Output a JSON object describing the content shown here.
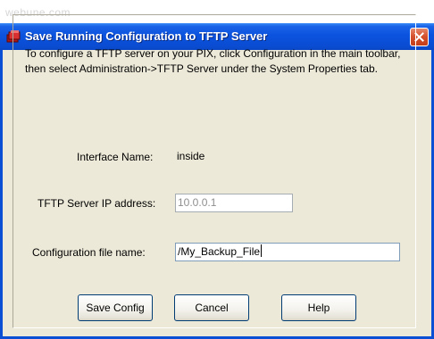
{
  "watermark": "webune.com",
  "window": {
    "title": "Save Running Configuration to TFTP Server",
    "icon": "application-icon",
    "close_icon": "close-icon"
  },
  "dialog": {
    "instructions": "To configure a TFTP server on your PIX, click Configuration in the main toolbar, then select Administration->TFTP Server under the System Properties tab.",
    "interface_label": "Interface Name:",
    "interface_value": "inside",
    "tftp_ip_label": "TFTP Server IP address:",
    "tftp_ip_value": "10.0.0.1",
    "config_file_label": "Configuration file name:",
    "config_file_value": "/My_Backup_File"
  },
  "buttons": {
    "save": "Save Config",
    "cancel": "Cancel",
    "help": "Help"
  },
  "colors": {
    "titlebar": "#0a4cd2",
    "dialog_bg": "#ece9d8",
    "close_button": "#d6522e"
  }
}
